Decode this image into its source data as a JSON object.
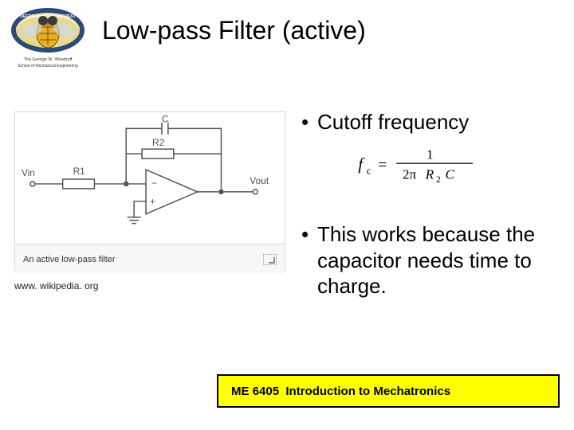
{
  "title": "Low-pass Filter (active)",
  "logo": {
    "top_text": "DEGREES ABOVE THE REST",
    "school_line1": "The George W. Woodruff",
    "school_line2": "School of Mechanical Engineering"
  },
  "circuit": {
    "caption": "An active low-pass filter",
    "labels": {
      "vin": "Vin",
      "r1": "R1",
      "r2": "R2",
      "c": "C",
      "minus": "−",
      "plus": "+",
      "vout": "Vout"
    }
  },
  "source": "www. wikipedia. org",
  "bullets": {
    "b1": "Cutoff frequency",
    "b2": "This works because the capacitor needs time to charge."
  },
  "formula": {
    "lhs": "f",
    "lhs_sub": "c",
    "eq": "=",
    "num": "1",
    "den_pre": "2π",
    "den_r": "R",
    "den_r_sub": "2",
    "den_c": "C"
  },
  "footer": {
    "course": "ME 6405",
    "title": "Introduction to Mechatronics"
  }
}
